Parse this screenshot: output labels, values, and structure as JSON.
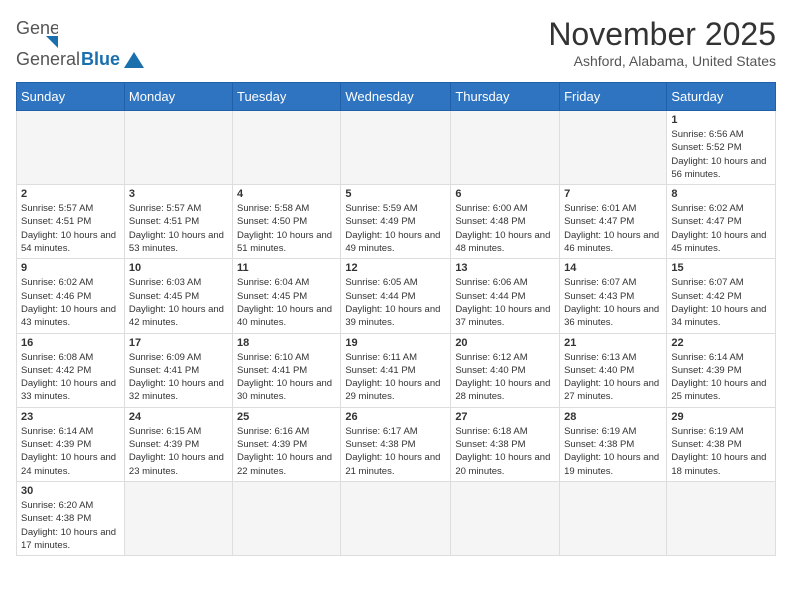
{
  "header": {
    "logo_general": "General",
    "logo_blue": "Blue",
    "month_title": "November 2025",
    "location": "Ashford, Alabama, United States"
  },
  "days_of_week": [
    "Sunday",
    "Monday",
    "Tuesday",
    "Wednesday",
    "Thursday",
    "Friday",
    "Saturday"
  ],
  "weeks": [
    [
      {
        "day": "",
        "info": ""
      },
      {
        "day": "",
        "info": ""
      },
      {
        "day": "",
        "info": ""
      },
      {
        "day": "",
        "info": ""
      },
      {
        "day": "",
        "info": ""
      },
      {
        "day": "",
        "info": ""
      },
      {
        "day": "1",
        "info": "Sunrise: 6:56 AM\nSunset: 5:52 PM\nDaylight: 10 hours and 56 minutes."
      }
    ],
    [
      {
        "day": "2",
        "info": "Sunrise: 5:57 AM\nSunset: 4:51 PM\nDaylight: 10 hours and 54 minutes."
      },
      {
        "day": "3",
        "info": "Sunrise: 5:57 AM\nSunset: 4:51 PM\nDaylight: 10 hours and 53 minutes."
      },
      {
        "day": "4",
        "info": "Sunrise: 5:58 AM\nSunset: 4:50 PM\nDaylight: 10 hours and 51 minutes."
      },
      {
        "day": "5",
        "info": "Sunrise: 5:59 AM\nSunset: 4:49 PM\nDaylight: 10 hours and 49 minutes."
      },
      {
        "day": "6",
        "info": "Sunrise: 6:00 AM\nSunset: 4:48 PM\nDaylight: 10 hours and 48 minutes."
      },
      {
        "day": "7",
        "info": "Sunrise: 6:01 AM\nSunset: 4:47 PM\nDaylight: 10 hours and 46 minutes."
      },
      {
        "day": "8",
        "info": "Sunrise: 6:02 AM\nSunset: 4:47 PM\nDaylight: 10 hours and 45 minutes."
      }
    ],
    [
      {
        "day": "9",
        "info": "Sunrise: 6:02 AM\nSunset: 4:46 PM\nDaylight: 10 hours and 43 minutes."
      },
      {
        "day": "10",
        "info": "Sunrise: 6:03 AM\nSunset: 4:45 PM\nDaylight: 10 hours and 42 minutes."
      },
      {
        "day": "11",
        "info": "Sunrise: 6:04 AM\nSunset: 4:45 PM\nDaylight: 10 hours and 40 minutes."
      },
      {
        "day": "12",
        "info": "Sunrise: 6:05 AM\nSunset: 4:44 PM\nDaylight: 10 hours and 39 minutes."
      },
      {
        "day": "13",
        "info": "Sunrise: 6:06 AM\nSunset: 4:44 PM\nDaylight: 10 hours and 37 minutes."
      },
      {
        "day": "14",
        "info": "Sunrise: 6:07 AM\nSunset: 4:43 PM\nDaylight: 10 hours and 36 minutes."
      },
      {
        "day": "15",
        "info": "Sunrise: 6:07 AM\nSunset: 4:42 PM\nDaylight: 10 hours and 34 minutes."
      }
    ],
    [
      {
        "day": "16",
        "info": "Sunrise: 6:08 AM\nSunset: 4:42 PM\nDaylight: 10 hours and 33 minutes."
      },
      {
        "day": "17",
        "info": "Sunrise: 6:09 AM\nSunset: 4:41 PM\nDaylight: 10 hours and 32 minutes."
      },
      {
        "day": "18",
        "info": "Sunrise: 6:10 AM\nSunset: 4:41 PM\nDaylight: 10 hours and 30 minutes."
      },
      {
        "day": "19",
        "info": "Sunrise: 6:11 AM\nSunset: 4:41 PM\nDaylight: 10 hours and 29 minutes."
      },
      {
        "day": "20",
        "info": "Sunrise: 6:12 AM\nSunset: 4:40 PM\nDaylight: 10 hours and 28 minutes."
      },
      {
        "day": "21",
        "info": "Sunrise: 6:13 AM\nSunset: 4:40 PM\nDaylight: 10 hours and 27 minutes."
      },
      {
        "day": "22",
        "info": "Sunrise: 6:14 AM\nSunset: 4:39 PM\nDaylight: 10 hours and 25 minutes."
      }
    ],
    [
      {
        "day": "23",
        "info": "Sunrise: 6:14 AM\nSunset: 4:39 PM\nDaylight: 10 hours and 24 minutes."
      },
      {
        "day": "24",
        "info": "Sunrise: 6:15 AM\nSunset: 4:39 PM\nDaylight: 10 hours and 23 minutes."
      },
      {
        "day": "25",
        "info": "Sunrise: 6:16 AM\nSunset: 4:39 PM\nDaylight: 10 hours and 22 minutes."
      },
      {
        "day": "26",
        "info": "Sunrise: 6:17 AM\nSunset: 4:38 PM\nDaylight: 10 hours and 21 minutes."
      },
      {
        "day": "27",
        "info": "Sunrise: 6:18 AM\nSunset: 4:38 PM\nDaylight: 10 hours and 20 minutes."
      },
      {
        "day": "28",
        "info": "Sunrise: 6:19 AM\nSunset: 4:38 PM\nDaylight: 10 hours and 19 minutes."
      },
      {
        "day": "29",
        "info": "Sunrise: 6:19 AM\nSunset: 4:38 PM\nDaylight: 10 hours and 18 minutes."
      }
    ],
    [
      {
        "day": "30",
        "info": "Sunrise: 6:20 AM\nSunset: 4:38 PM\nDaylight: 10 hours and 17 minutes."
      },
      {
        "day": "",
        "info": ""
      },
      {
        "day": "",
        "info": ""
      },
      {
        "day": "",
        "info": ""
      },
      {
        "day": "",
        "info": ""
      },
      {
        "day": "",
        "info": ""
      },
      {
        "day": "",
        "info": ""
      }
    ]
  ]
}
